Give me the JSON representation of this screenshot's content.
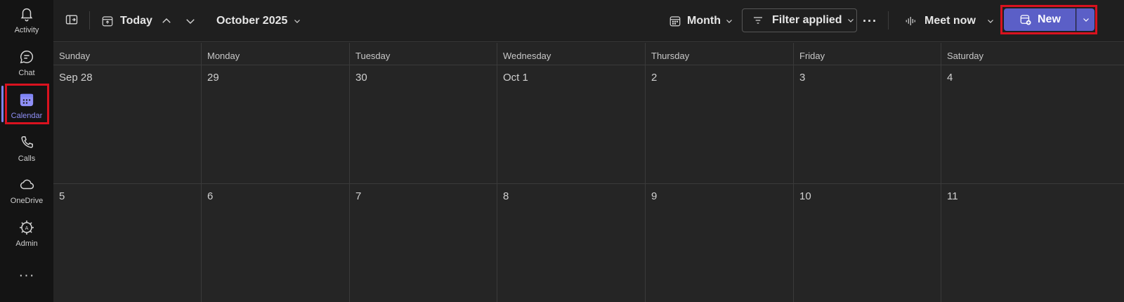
{
  "rail": {
    "items": [
      {
        "id": "activity",
        "label": "Activity",
        "icon": "bell-icon"
      },
      {
        "id": "chat",
        "label": "Chat",
        "icon": "chat-icon"
      },
      {
        "id": "calendar",
        "label": "Calendar",
        "icon": "calendar-icon"
      },
      {
        "id": "calls",
        "label": "Calls",
        "icon": "phone-icon"
      },
      {
        "id": "onedrive",
        "label": "OneDrive",
        "icon": "cloud-icon"
      },
      {
        "id": "admin",
        "label": "Admin",
        "icon": "admin-gear-icon"
      }
    ],
    "more": "···",
    "active_color": "#7f85f5"
  },
  "toolbar": {
    "today": "Today",
    "month_label": "October 2025",
    "view": "Month",
    "filter": "Filter applied",
    "more": "···",
    "meet_now": "Meet now",
    "new": "New",
    "accent": "#5b5fc7"
  },
  "calendar": {
    "weekdays": [
      "Sunday",
      "Monday",
      "Tuesday",
      "Wednesday",
      "Thursday",
      "Friday",
      "Saturday"
    ],
    "weeks": [
      [
        "Sep 28",
        "29",
        "30",
        "Oct 1",
        "2",
        "3",
        "4"
      ],
      [
        "5",
        "6",
        "7",
        "8",
        "9",
        "10",
        "11"
      ]
    ]
  }
}
